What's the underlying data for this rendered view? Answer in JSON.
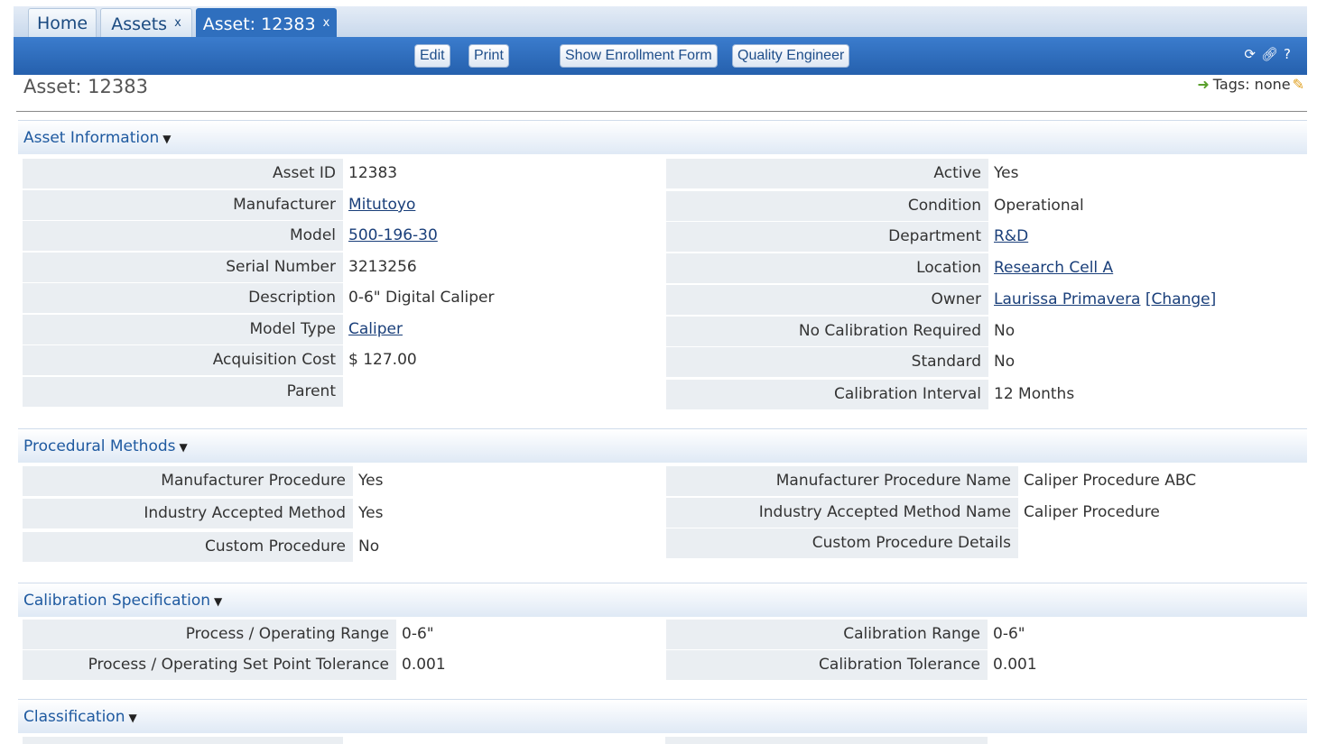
{
  "tabs": [
    {
      "label": "Home",
      "closable": false
    },
    {
      "label": "Assets",
      "closable": true
    },
    {
      "label": "Asset: 12383",
      "closable": true,
      "active": true
    }
  ],
  "tab_close_glyph": "x",
  "toolbar": {
    "buttons": [
      "Edit",
      "Print",
      "Show Enrollment Form",
      "Quality Engineer"
    ],
    "icons": [
      "refresh-icon",
      "link-icon",
      "help-icon"
    ]
  },
  "page_title": "Asset: 12383",
  "tags": {
    "label": "Tags: none"
  },
  "sections": {
    "asset_info": {
      "title": "Asset Information",
      "left": [
        {
          "label": "Asset ID",
          "value": "12383"
        },
        {
          "label": "Manufacturer",
          "value": "Mitutoyo",
          "link": true
        },
        {
          "label": "Model",
          "value": "500-196-30",
          "link": true
        },
        {
          "label": "Serial Number",
          "value": "3213256"
        },
        {
          "label": "Description",
          "value": "0-6\" Digital Caliper"
        },
        {
          "label": "Model Type",
          "value": "Caliper",
          "link": true
        },
        {
          "label": "Acquisition Cost",
          "value": "$ 127.00"
        },
        {
          "label": "Parent",
          "value": ""
        }
      ],
      "right": [
        {
          "label": "Active",
          "value": "Yes"
        },
        {
          "label": "Condition",
          "value": "Operational"
        },
        {
          "label": "Department",
          "value": "R&D",
          "link": true
        },
        {
          "label": "Location",
          "value": "Research Cell A",
          "link": true
        },
        {
          "label": "Owner",
          "value": "Laurissa Primavera",
          "link": true,
          "extra": "[Change]"
        },
        {
          "label": "No Calibration Required",
          "value": "No"
        },
        {
          "label": "Standard",
          "value": "No"
        },
        {
          "label": "Calibration Interval",
          "value": "12 Months"
        }
      ]
    },
    "procedural": {
      "title": "Procedural Methods",
      "left": [
        {
          "label": "Manufacturer Procedure",
          "value": "Yes"
        },
        {
          "label": "Industry Accepted Method",
          "value": "Yes"
        },
        {
          "label": "Custom Procedure",
          "value": "No"
        }
      ],
      "right": [
        {
          "label": "Manufacturer Procedure Name",
          "value": "Caliper Procedure ABC"
        },
        {
          "label": "Industry Accepted Method Name",
          "value": "Caliper Procedure"
        },
        {
          "label": "Custom Procedure Details",
          "value": ""
        }
      ]
    },
    "calibration": {
      "title": "Calibration Specification",
      "left": [
        {
          "label": "Process / Operating Range",
          "value": "0-6\""
        },
        {
          "label": "Process / Operating Set Point Tolerance",
          "value": "0.001"
        }
      ],
      "right": [
        {
          "label": "Calibration Range",
          "value": "0-6\""
        },
        {
          "label": "Calibration Tolerance",
          "value": "0.001"
        }
      ]
    },
    "classification": {
      "title": "Classification"
    }
  },
  "colors": {
    "accent": "#2f6fbe",
    "link": "#1a3f7a",
    "label_bg": "#eaeef2",
    "section_title": "#1f5aa0"
  }
}
